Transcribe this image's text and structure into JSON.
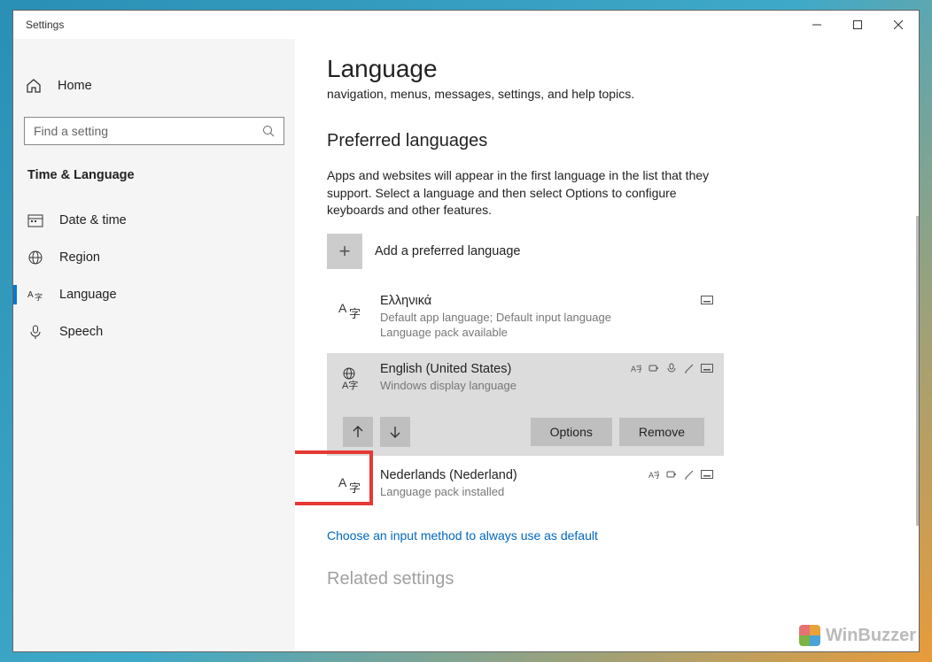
{
  "window": {
    "title": "Settings"
  },
  "sidebar": {
    "home": "Home",
    "search_placeholder": "Find a setting",
    "category": "Time & Language",
    "items": [
      {
        "label": "Date & time"
      },
      {
        "label": "Region"
      },
      {
        "label": "Language"
      },
      {
        "label": "Speech"
      }
    ]
  },
  "page": {
    "title": "Language",
    "truncated_line": "navigation, menus, messages, settings, and help topics.",
    "section_title": "Preferred languages",
    "section_desc": "Apps and websites will appear in the first language in the list that they support. Select a language and then select Options to configure keyboards and other features.",
    "add_label": "Add a preferred language",
    "languages": [
      {
        "name": "Ελληνικά",
        "sub1": "Default app language; Default input language",
        "sub2": "Language pack available"
      },
      {
        "name": "English (United States)",
        "sub1": "Windows display language",
        "sub2": ""
      },
      {
        "name": "Nederlands (Nederland)",
        "sub1": "Language pack installed",
        "sub2": ""
      }
    ],
    "options_label": "Options",
    "remove_label": "Remove",
    "choose_link": "Choose an input method to always use as default",
    "related": "Related settings"
  },
  "watermark": "WinBuzzer"
}
